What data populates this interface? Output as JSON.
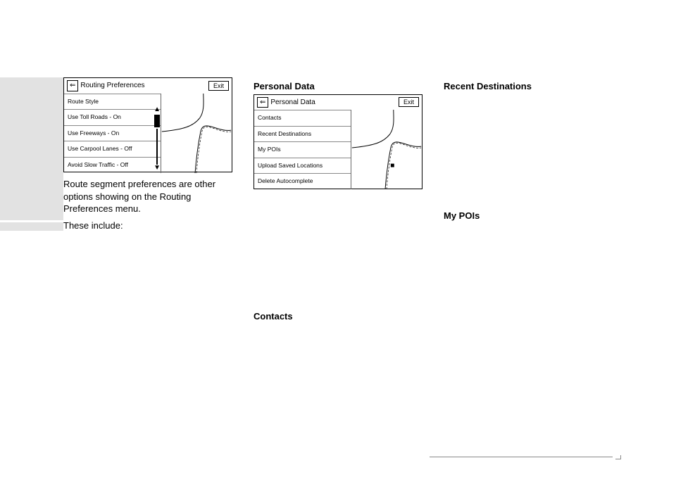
{
  "col1": {
    "fig": {
      "back": "⇐",
      "title": "Routing Preferences",
      "exit": "Exit",
      "items": [
        "Route Style",
        "Use Toll Roads - On",
        "Use Freeways - On",
        "Use Carpool Lanes - Off",
        "Avoid Slow Traffic - Off"
      ]
    },
    "p1": "Route segment preferences are other options showing on the Routing Preferences menu.",
    "p2": "These include:"
  },
  "col2": {
    "h1": "Personal Data",
    "fig": {
      "back": "⇐",
      "title": "Personal Data",
      "exit": "Exit",
      "items": [
        "Contacts",
        "Recent Destinations",
        "My POIs",
        "Upload Saved Locations",
        "Delete Autocomplete"
      ]
    },
    "h2": "Contacts"
  },
  "col3": {
    "h1": "Recent Destinations",
    "h2": "My POIs"
  }
}
